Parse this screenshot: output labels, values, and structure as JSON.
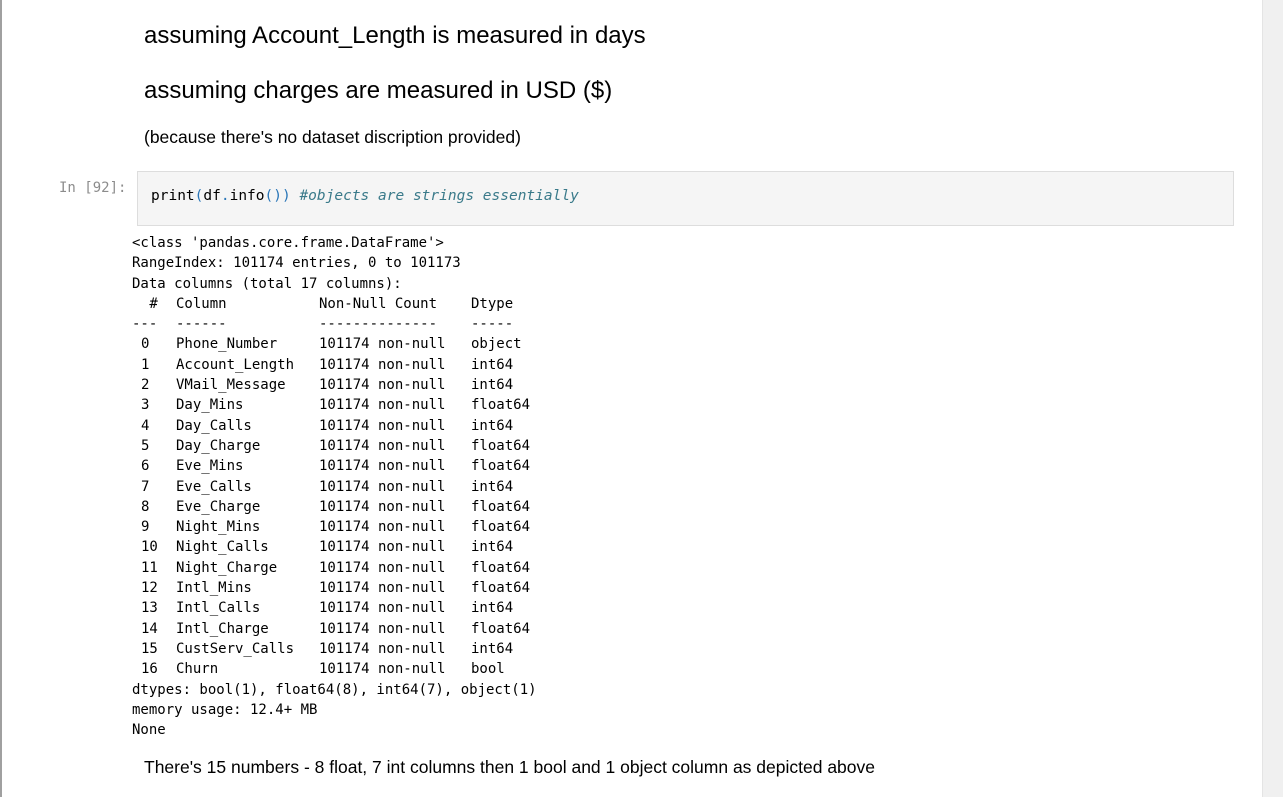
{
  "markdown": {
    "heading1": "assuming Account_Length is measured in days",
    "heading2": "assuming charges are measured in USD ($)",
    "note": "(because there's no dataset discription provided)",
    "footer": "There's 15 numbers - 8 float, 7 int columns then 1 bool and 1 object column as depicted above"
  },
  "code_cell": {
    "prompt": "In [92]:",
    "code_func": "print",
    "code_open": "(",
    "code_obj": "df",
    "code_dot": ".",
    "code_method": "info",
    "code_parens": "())",
    "code_comment": "#objects are strings essentially"
  },
  "output": {
    "class_line": "<class 'pandas.core.frame.DataFrame'>",
    "range_index": "RangeIndex: 101174 entries, 0 to 101173",
    "data_columns": "Data columns (total 17 columns):",
    "header": {
      "idx": " #",
      "name": "Column",
      "count": "Non-Null Count",
      "dtype": "Dtype"
    },
    "divider": {
      "idx": "---",
      "name": "------",
      "count": "--------------",
      "dtype": "-----"
    },
    "columns": [
      {
        "idx": "0",
        "name": "Phone_Number",
        "count": "101174 non-null",
        "dtype": "object"
      },
      {
        "idx": "1",
        "name": "Account_Length",
        "count": "101174 non-null",
        "dtype": "int64"
      },
      {
        "idx": "2",
        "name": "VMail_Message",
        "count": "101174 non-null",
        "dtype": "int64"
      },
      {
        "idx": "3",
        "name": "Day_Mins",
        "count": "101174 non-null",
        "dtype": "float64"
      },
      {
        "idx": "4",
        "name": "Day_Calls",
        "count": "101174 non-null",
        "dtype": "int64"
      },
      {
        "idx": "5",
        "name": "Day_Charge",
        "count": "101174 non-null",
        "dtype": "float64"
      },
      {
        "idx": "6",
        "name": "Eve_Mins",
        "count": "101174 non-null",
        "dtype": "float64"
      },
      {
        "idx": "7",
        "name": "Eve_Calls",
        "count": "101174 non-null",
        "dtype": "int64"
      },
      {
        "idx": "8",
        "name": "Eve_Charge",
        "count": "101174 non-null",
        "dtype": "float64"
      },
      {
        "idx": "9",
        "name": "Night_Mins",
        "count": "101174 non-null",
        "dtype": "float64"
      },
      {
        "idx": "10",
        "name": "Night_Calls",
        "count": "101174 non-null",
        "dtype": "int64"
      },
      {
        "idx": "11",
        "name": "Night_Charge",
        "count": "101174 non-null",
        "dtype": "float64"
      },
      {
        "idx": "12",
        "name": "Intl_Mins",
        "count": "101174 non-null",
        "dtype": "float64"
      },
      {
        "idx": "13",
        "name": "Intl_Calls",
        "count": "101174 non-null",
        "dtype": "int64"
      },
      {
        "idx": "14",
        "name": "Intl_Charge",
        "count": "101174 non-null",
        "dtype": "float64"
      },
      {
        "idx": "15",
        "name": "CustServ_Calls",
        "count": "101174 non-null",
        "dtype": "int64"
      },
      {
        "idx": "16",
        "name": "Churn",
        "count": "101174 non-null",
        "dtype": "bool"
      }
    ],
    "dtypes_line": "dtypes: bool(1), float64(8), int64(7), object(1)",
    "memory_line": "memory usage: 12.4+ MB",
    "none_line": "None"
  },
  "colors": {
    "prompt": "#8c8c8c",
    "code_bg": "#f5f5f5",
    "code_border": "#dddddd",
    "operator": "#2a76b8",
    "comment": "#3a7a8a"
  }
}
